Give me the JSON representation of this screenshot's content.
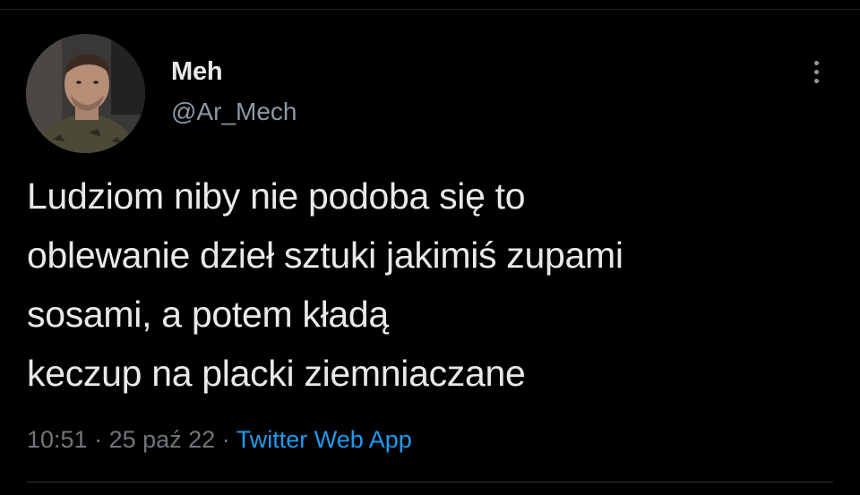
{
  "author": {
    "display_name": "Meh",
    "handle": "@Ar_Mech"
  },
  "tweet": {
    "lines": [
      "Ludziom niby nie podoba się to",
      "oblewanie dzieł sztuki jakimiś zupami",
      "sosami, a potem kładą",
      "keczup na placki ziemniaczane"
    ]
  },
  "meta": {
    "time": "10:51",
    "separator": " · ",
    "date": "25 paź 22",
    "source": "Twitter Web App"
  },
  "icons": {
    "more": "more-vertical-icon"
  },
  "colors": {
    "background": "#000000",
    "text": "#e7e9ea",
    "secondary": "#71767b",
    "link": "#1d9bf0"
  }
}
